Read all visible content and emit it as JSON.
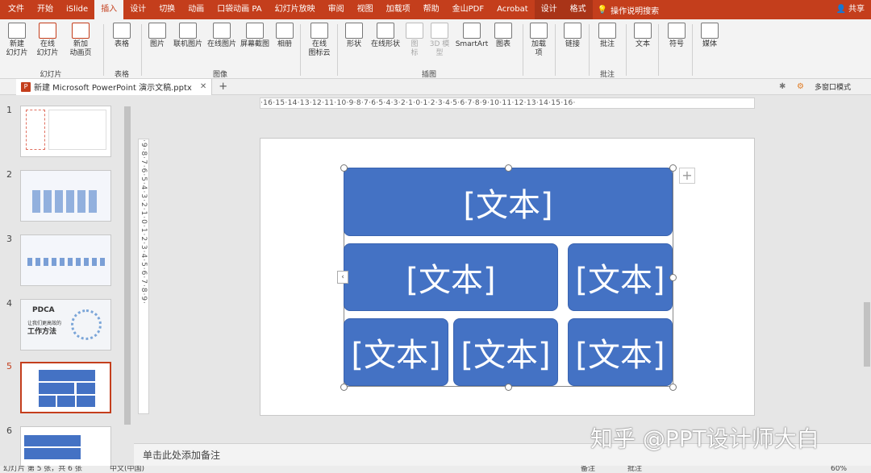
{
  "menu": {
    "tabs": [
      "文件",
      "开始",
      "iSlide",
      "插入",
      "设计",
      "切换",
      "动画",
      "口袋动画 PA",
      "幻灯片放映",
      "审阅",
      "视图",
      "加载项",
      "帮助",
      "金山PDF",
      "Acrobat",
      "设计",
      "格式"
    ],
    "active_tab": "插入",
    "search_label": "操作说明搜索",
    "share_label": "共享"
  },
  "ribbon": {
    "buttons": {
      "new_slide": "新建\n幻灯片",
      "online_slide": "在线\n幻灯片",
      "new_animation": "新加\n动画页",
      "table": "表格",
      "picture": "图片",
      "online_picture": "联机图片",
      "online_picture2": "在线图片",
      "screenshot": "屏幕截图",
      "album": "相册",
      "online_icons": "在线\n图标云",
      "shapes": "形状",
      "online_shapes": "在线形状",
      "icon": "图\n标",
      "model3d": "3D 模\n型",
      "smartart": "SmartArt",
      "chart": "图表",
      "addins": "加载\n项",
      "link": "链接",
      "comment": "批注",
      "text": "文本",
      "symbol": "符号",
      "media": "媒体"
    },
    "groups": {
      "slides": "幻灯片",
      "tables": "表格",
      "images": "图像",
      "illustrations": "插图",
      "comments": "批注"
    }
  },
  "document": {
    "tab_title": "新建 Microsoft PowerPoint 演示文稿.pptx",
    "multi_window": "多窗口模式"
  },
  "thumbnails": {
    "numbers": [
      "1",
      "2",
      "3",
      "4",
      "5",
      "6"
    ],
    "selected": "5",
    "slide4_title": "PDCA",
    "slide4_sub": "让我们更高效的",
    "slide4_sub2": "工作方法"
  },
  "ruler": {
    "horizontal": "·16·15·14·13·12·11·10·9·8·7·6·5·4·3·2·1·0·1·2·3·4·5·6·7·8·9·10·11·12·13·14·15·16·",
    "vertical": "·9·8·7·6·5·4·3·2·1·0·1·2·3·4·5·6·7·8·9·"
  },
  "smartart": {
    "boxes": [
      "[文本]",
      "[文本]",
      "[文本]",
      "[文本]",
      "[文本]",
      "[文本]"
    ],
    "box_color": "#4472c4"
  },
  "notes_placeholder": "单击此处添加备注",
  "status": {
    "slide_info": "幻灯片 第 5 张，共 6 张",
    "language": "中文(中国)",
    "notes": "备注",
    "comments": "批注",
    "zoom": "60%"
  },
  "watermark": "知乎 @PPT设计师大白"
}
